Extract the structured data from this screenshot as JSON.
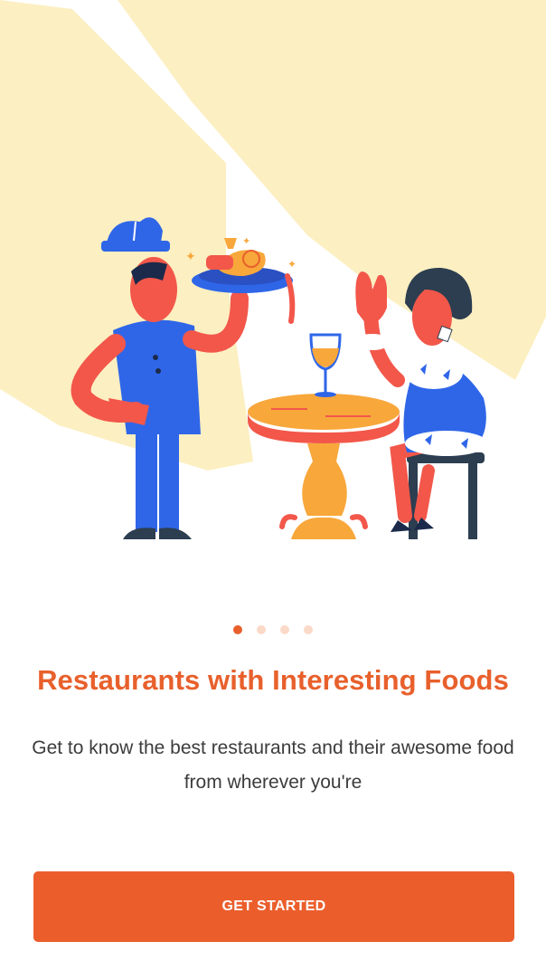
{
  "onboarding": {
    "title": "Restaurants with Interesting Foods",
    "subtitle": "Get to know the best restaurants and their awesome food from wherever you're",
    "cta_label": "GET STARTED",
    "pager": {
      "count": 4,
      "active_index": 0
    }
  },
  "colors": {
    "accent": "#eb5e2c",
    "dot_inactive": "#fbd9c8",
    "background_shape": "#fcefc1"
  }
}
